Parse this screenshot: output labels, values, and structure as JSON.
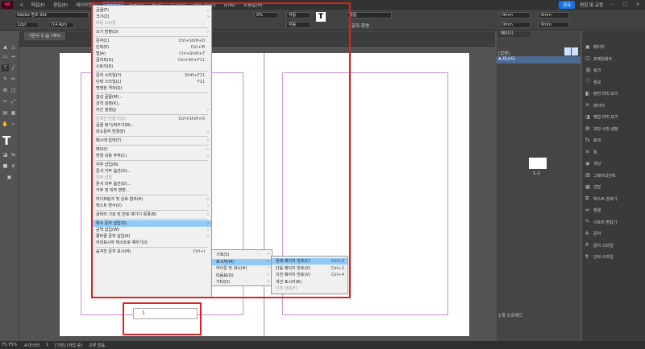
{
  "menubar": {
    "logo": "Id",
    "items": [
      "파일(F)",
      "편집(E)",
      "레이아웃(L)",
      "문자(T)",
      "개체(O)",
      "표(A)",
      "보기(V)",
      "플러그인(P)",
      "창(W)",
      "도움말(H)"
    ],
    "share": "공유",
    "workspace": "편집 및 교정"
  },
  "control": {
    "font": "Adobe 명조 Std",
    "size": "12pt",
    "leading": "(14.4pt)",
    "tracking": "0%",
    "auto1": "자동",
    "auto2": "자동",
    "lang": "없음",
    "zero1": "0mm",
    "zero2": "0mm",
    "zero3": "0mm",
    "zero4": "0mm",
    "mode": "문자 화면",
    "pct": "100%"
  },
  "doc_tab": "*문서 1 @ 76%",
  "toolbox": {
    "type_icon": "T"
  },
  "menu": {
    "items": [
      {
        "l": "글꼴(F)",
        "s": "",
        "sub": true
      },
      {
        "l": "크기(Z)",
        "s": "",
        "sub": true
      },
      {
        "l": "자동 스타일",
        "s": "",
        "dis": true
      },
      {
        "sep": true
      },
      {
        "l": "쓰기 방향(D)",
        "s": "",
        "sub": true
      },
      {
        "sep": true
      },
      {
        "l": "문자(C)",
        "s": "Ctrl+Shift+D"
      },
      {
        "l": "단락(P)",
        "s": "Ctrl+M"
      },
      {
        "l": "탭(A)",
        "s": "Ctrl+Shift+T"
      },
      {
        "l": "글리프(G)",
        "s": "Ctrl+Alt+F11"
      },
      {
        "l": "스토리(R)",
        "s": ""
      },
      {
        "sep": true
      },
      {
        "l": "문자 스타일(Y)",
        "s": "Shift+F11"
      },
      {
        "l": "단락 스타일(L)",
        "s": "F11"
      },
      {
        "l": "명명된 격자(Q)",
        "s": ""
      },
      {
        "sep": true
      },
      {
        "l": "합성 글꼴(M)...",
        "s": ""
      },
      {
        "l": "금칙 설정(K)...",
        "s": ""
      },
      {
        "l": "자간 설정(J)",
        "s": "",
        "sub": true
      },
      {
        "sep": true
      },
      {
        "l": "윤곽선 만들기(O)",
        "s": "Ctrl+Shift+O",
        "dis": true
      },
      {
        "l": "글꼴 찾기/바꾸기(N)...",
        "s": ""
      },
      {
        "l": "대소문자 변경(E)",
        "s": "",
        "sub": true
      },
      {
        "sep": true
      },
      {
        "l": "패스에 입력(T)",
        "s": "",
        "sub": true
      },
      {
        "sep": true
      },
      {
        "l": "메모(I)",
        "s": "",
        "sub": true
      },
      {
        "l": "변경 내용 추적(C)",
        "s": "",
        "sub": true
      },
      {
        "sep": true
      },
      {
        "l": "각주 삽입(N)",
        "s": ""
      },
      {
        "l": "문서 각주 옵션(D)...",
        "s": ""
      },
      {
        "l": "미주 삽입",
        "s": "",
        "dis": true
      },
      {
        "l": "문서 미주 옵션(D)...",
        "s": ""
      },
      {
        "l": "각주 및 미주 변환...",
        "s": ""
      },
      {
        "sep": true
      },
      {
        "l": "하이퍼링크 및 상호 참조(H)",
        "s": "",
        "sub": true
      },
      {
        "l": "텍스트 변수(V)",
        "s": "",
        "sub": true
      },
      {
        "sep": true
      },
      {
        "l": "글머리 기호 및 번호 매기기 목록(B)",
        "s": "",
        "sub": true
      },
      {
        "sep": true
      },
      {
        "l": "특수 문자 삽입(S)",
        "s": "",
        "sub": true,
        "hl": true
      },
      {
        "l": "공백 삽입(W)",
        "s": "",
        "sub": true
      },
      {
        "l": "줄바꿈 문자 삽입(K)",
        "s": "",
        "sub": true
      },
      {
        "l": "자리표시자 텍스트로 채우기(I)",
        "s": ""
      },
      {
        "sep": true
      },
      {
        "l": "숨겨진 문자 표시(H)",
        "s": "Ctrl+I"
      }
    ]
  },
  "submenu1": [
    "기호(S)",
    "표시자(M)",
    "하이픈 및 대시(H)",
    "따옴표(Q)",
    "기타(O)"
  ],
  "submenu2": [
    "하이픈 및 대시(H)"
  ],
  "submenu3": [
    {
      "l": "현재 페이지 번호(C)",
      "s": "Ctrl+3",
      "hl": true
    },
    {
      "l": "다음 페이지 번호(X)",
      "s": "Ctrl+2"
    },
    {
      "l": "이전 페이지 번호(V)",
      "s": "Ctrl+4"
    },
    {
      "l": "섹션 표시자(R)",
      "s": ""
    },
    {
      "l": "각주 번호(F)",
      "s": "",
      "dis": true
    }
  ],
  "page_number_box": "1",
  "pages_panel": {
    "tab": "페이지",
    "none": "[없음]",
    "master": "A-마스터",
    "spread": "1-2",
    "footer": "1개 스프레드"
  },
  "right_panel": [
    "페이지",
    "프레임워크",
    "링크",
    "정보",
    "분판 미리 보기",
    "레이어",
    "병합 미리 보기",
    "조판 사전 설정",
    "효과",
    "획",
    "색상",
    "그레이디언트",
    "견본",
    "텍스트 감싸기",
    "정렬",
    "스토리 편집기",
    "문자",
    "문자 스타일",
    "단락 스타일"
  ],
  "status": {
    "zoom": "75.75%",
    "master": "A-마스터",
    "page": "1",
    "base": "[기본] (작업 중)",
    "err": "오류 없음"
  }
}
